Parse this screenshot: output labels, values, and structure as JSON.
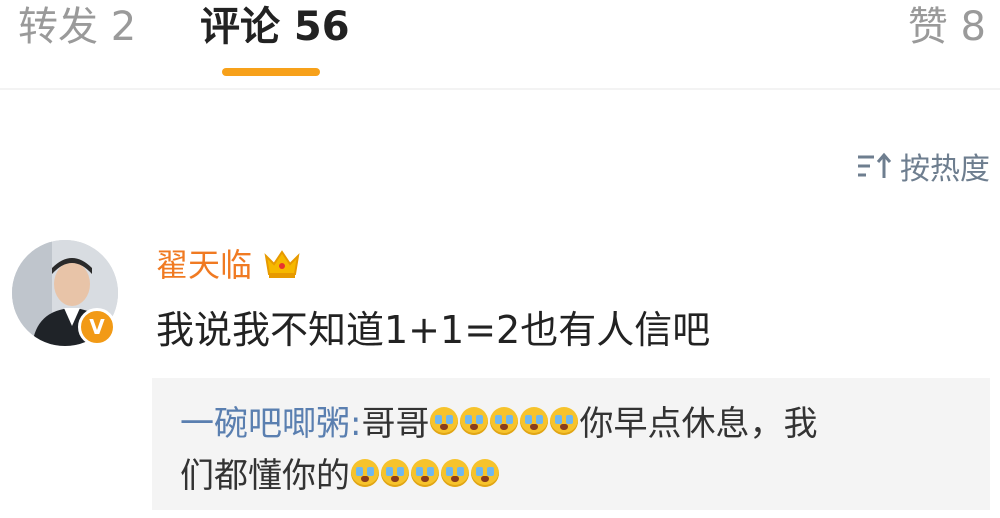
{
  "tabs": {
    "repost": "转发 2",
    "comments": "评论 56",
    "likes": "赞 8"
  },
  "sort": {
    "label": "按热度",
    "icon": "sort-icon"
  },
  "comment": {
    "username": "翟天临",
    "badge_icon": "crown-icon",
    "verified_badge": "V",
    "text": "我说我不知道1+1=2也有人信吧"
  },
  "reply": {
    "author": "一碗吧唧粥",
    "separator": ": ",
    "text_part1": "哥哥",
    "emoji_count_1": 5,
    "text_part2": "你早点休息，我",
    "text_part3": "们都懂你的",
    "emoji_count_2": 5,
    "emoji_name": "crying-emoji"
  },
  "colors": {
    "accent": "#f7a11a",
    "username": "#f07a22",
    "reply_author": "#5a7fb0"
  }
}
